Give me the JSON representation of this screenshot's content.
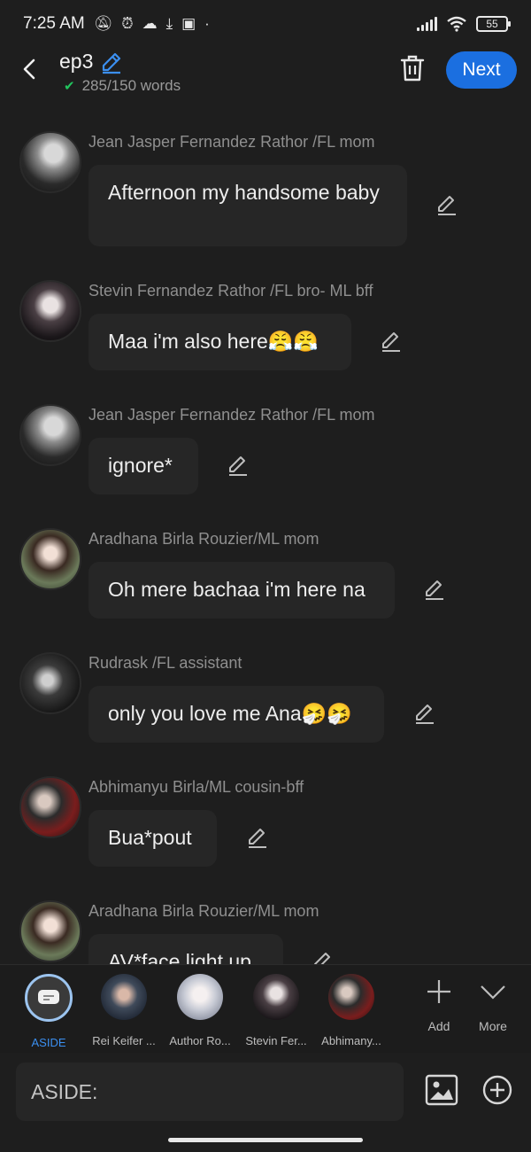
{
  "status_bar": {
    "time": "7:25 AM",
    "battery": "55"
  },
  "header": {
    "title": "ep3",
    "word_count": "285/150 words",
    "next_label": "Next"
  },
  "messages": [
    {
      "sender": "Jean Jasper Fernandez Rathor /FL mom",
      "text": "Afternoon my handsome baby"
    },
    {
      "sender": "Stevin Fernandez Rathor /FL bro- ML bff",
      "text": "Maa i'm also here😤😤"
    },
    {
      "sender": "Jean Jasper Fernandez Rathor /FL mom",
      "text": "ignore*"
    },
    {
      "sender": "Aradhana Birla Rouzier/ML mom",
      "text": "Oh mere bachaa i'm here na"
    },
    {
      "sender": "Rudrask /FL assistant",
      "text": "only you love me Ana🤧🤧"
    },
    {
      "sender": "Abhimanyu Birla/ML cousin-bff",
      "text": "Bua*pout"
    },
    {
      "sender": "Aradhana Birla Rouzier/ML mom",
      "text": "AV*face light up"
    }
  ],
  "characters": [
    {
      "label": "ASIDE"
    },
    {
      "label": "Rei Keifer ..."
    },
    {
      "label": "Author Ro..."
    },
    {
      "label": "Stevin Fer..."
    },
    {
      "label": "Abhimany..."
    }
  ],
  "tools": {
    "add_label": "Add",
    "more_label": "More"
  },
  "input": {
    "placeholder": "ASIDE:"
  },
  "colors": {
    "accent": "#1b6fe0",
    "check": "#22c55e",
    "background": "#1e1e1e",
    "bubble": "#262626"
  }
}
